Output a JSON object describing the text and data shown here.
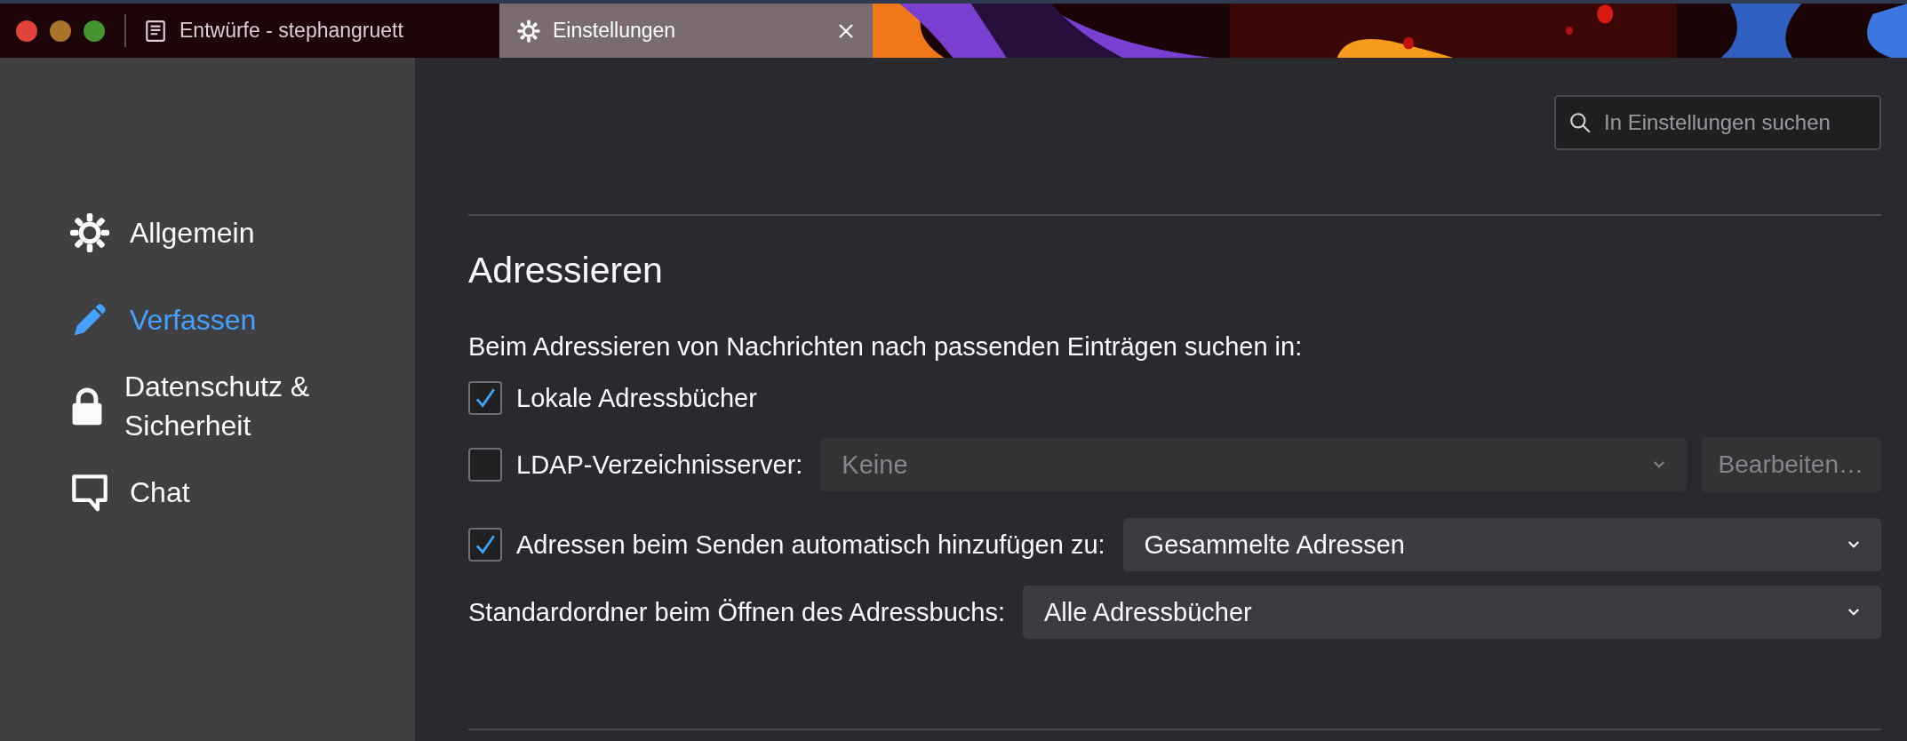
{
  "tabs": [
    {
      "label": "Entwürfe - stephangruett",
      "kind": "document",
      "selected": false
    },
    {
      "label": "Einstellungen",
      "kind": "settings",
      "selected": true
    }
  ],
  "sidebar": {
    "items": [
      {
        "label": "Allgemein",
        "kind": "general",
        "selected": false
      },
      {
        "label": "Verfassen",
        "kind": "compose",
        "selected": true
      },
      {
        "label": "Datenschutz & Sicherheit",
        "kind": "privacy",
        "selected": false
      },
      {
        "label": "Chat",
        "kind": "chat",
        "selected": false
      }
    ]
  },
  "search": {
    "placeholder": "In Einstellungen suchen"
  },
  "section": {
    "title": "Adressieren",
    "description": "Beim Adressieren von Nachrichten nach passenden Einträgen suchen in:",
    "options": [
      {
        "kind": "checkbox",
        "label": "Lokale Adressbücher",
        "checked": true
      },
      {
        "kind": "checkbox-select",
        "label": "LDAP-Verzeichnisserver:",
        "checked": false,
        "select": {
          "value": "Keine",
          "disabled": true
        },
        "button": {
          "label": "Bearbeiten…",
          "disabled": true
        }
      },
      {
        "kind": "checkbox-select",
        "label": "Adressen beim Senden automatisch hinzufügen zu:",
        "checked": true,
        "select": {
          "value": "Gesammelte Adressen",
          "disabled": false
        }
      },
      {
        "kind": "select",
        "label": "Standardordner beim Öffnen des Adressbuchs:",
        "select": {
          "value": "Alle Adressbücher",
          "disabled": false
        }
      }
    ]
  }
}
